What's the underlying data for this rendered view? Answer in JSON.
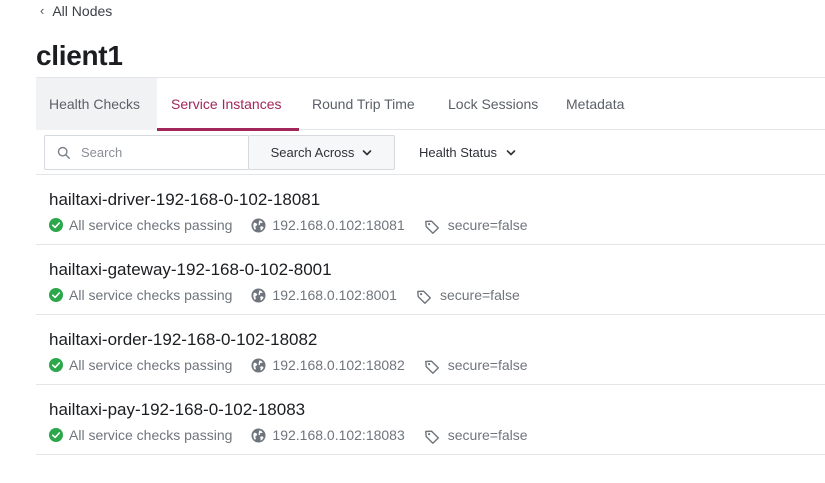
{
  "nav": {
    "back_label": "All Nodes"
  },
  "page": {
    "title": "client1"
  },
  "tabs": [
    {
      "label": "Health Checks"
    },
    {
      "label": "Service Instances"
    },
    {
      "label": "Round Trip Time"
    },
    {
      "label": "Lock Sessions"
    },
    {
      "label": "Metadata"
    }
  ],
  "active_tab": "Service Instances",
  "filters": {
    "search_placeholder": "Search",
    "search_across_label": "Search Across",
    "health_status_label": "Health Status"
  },
  "instances": [
    {
      "name": "hailtaxi-driver-192-168-0-102-18081",
      "status": "All service checks passing",
      "address": "192.168.0.102:18081",
      "tag": "secure=false"
    },
    {
      "name": "hailtaxi-gateway-192-168-0-102-8001",
      "status": "All service checks passing",
      "address": "192.168.0.102:8001",
      "tag": "secure=false"
    },
    {
      "name": "hailtaxi-order-192-168-0-102-18082",
      "status": "All service checks passing",
      "address": "192.168.0.102:18082",
      "tag": "secure=false"
    },
    {
      "name": "hailtaxi-pay-192-168-0-102-18083",
      "status": "All service checks passing",
      "address": "192.168.0.102:18083",
      "tag": "secure=false"
    }
  ],
  "colors": {
    "accent": "#a3265a",
    "passing": "#2ca74b",
    "border": "#e3e5e8"
  },
  "icons": {
    "back": "chevron-left-icon",
    "search": "search-icon",
    "dropdown": "chevron-down-icon",
    "status": "check-circle-icon",
    "address": "globe-icon",
    "tag": "tag-icon"
  }
}
